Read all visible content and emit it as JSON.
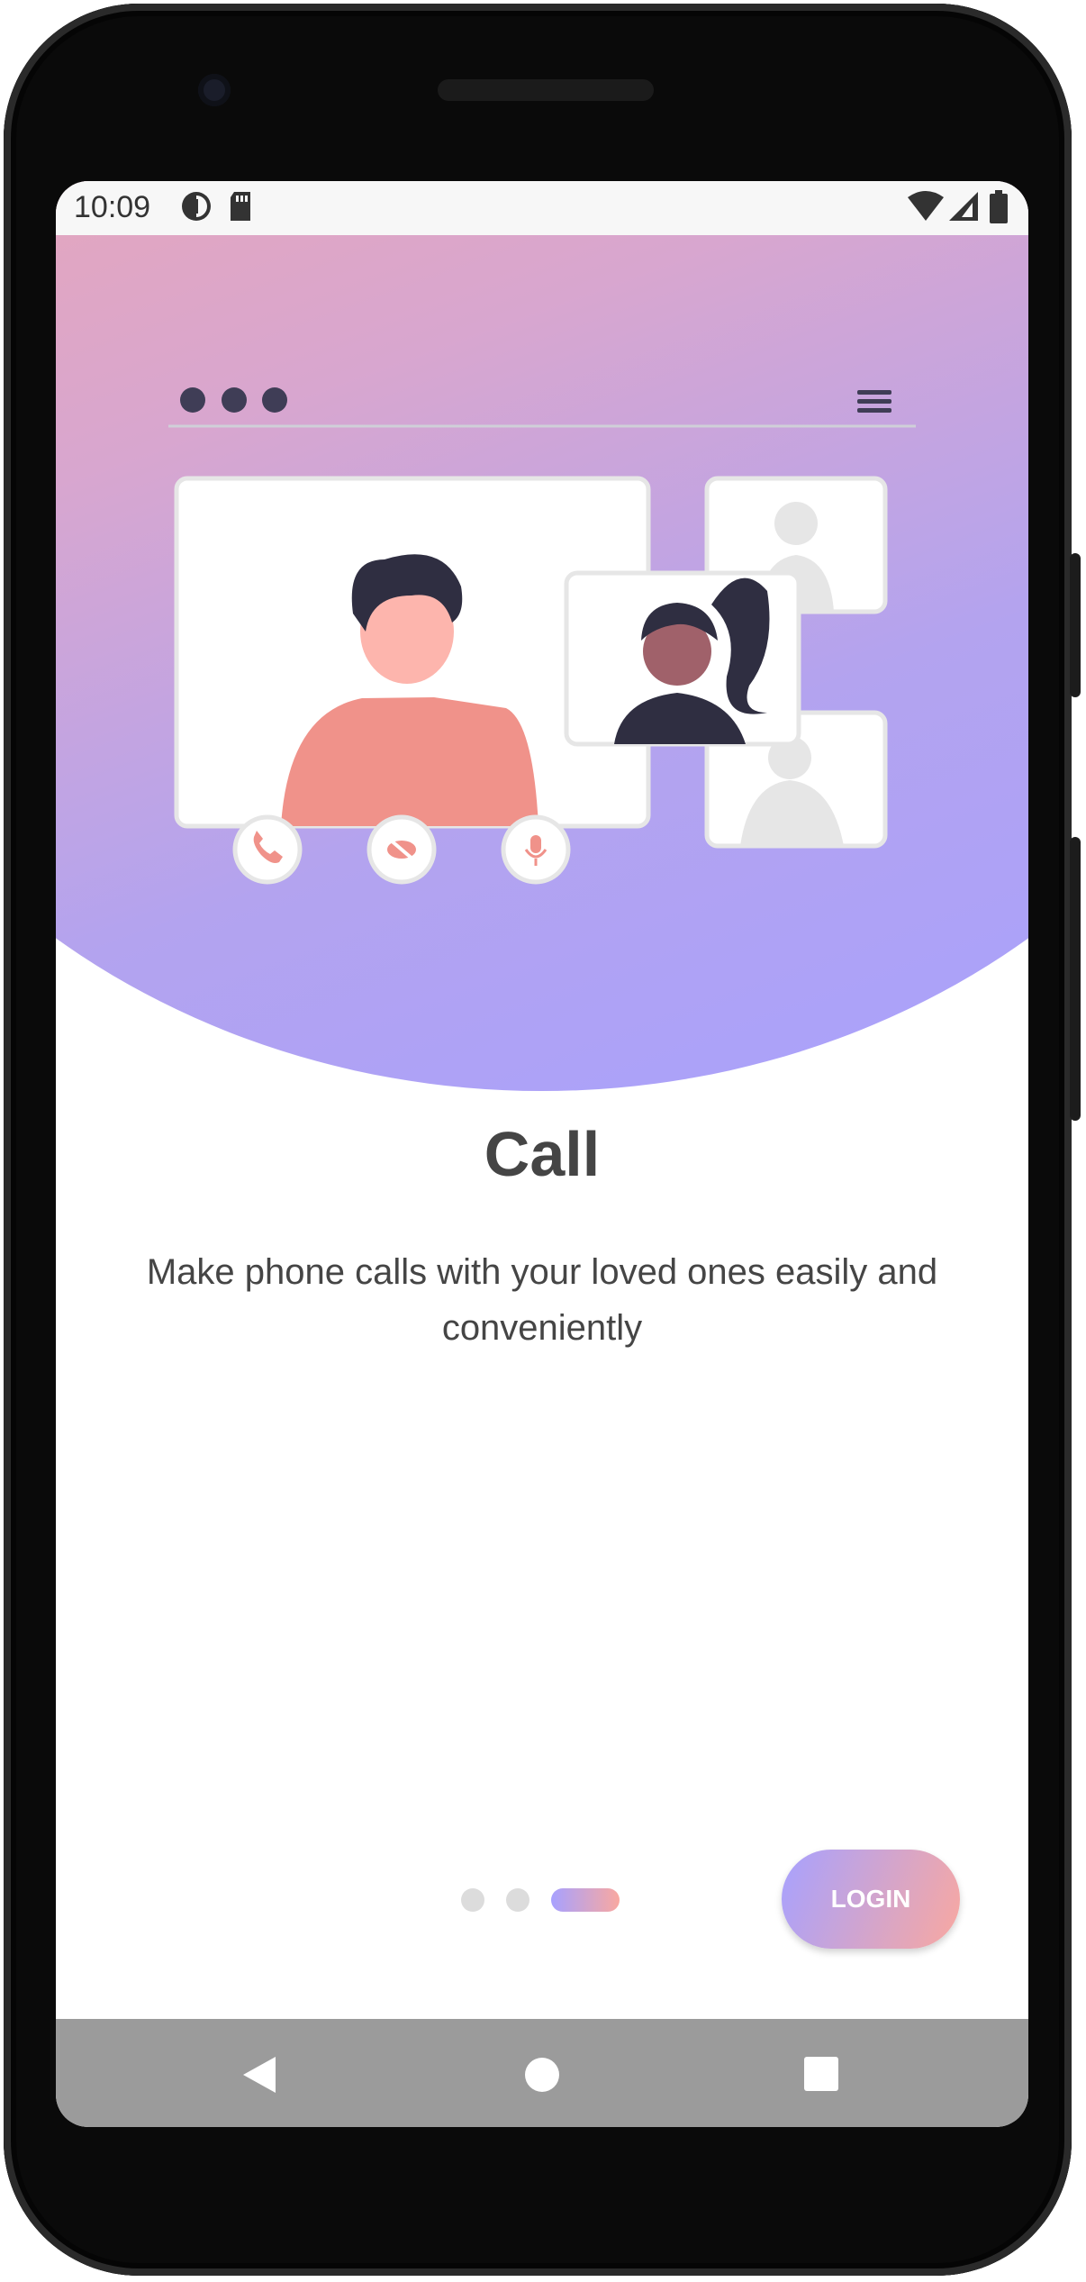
{
  "status_bar": {
    "time": "10:09",
    "left_icons": [
      "app-notification-icon",
      "sd-card-icon"
    ],
    "right_icons": [
      "wifi-icon",
      "cell-signal-icon",
      "battery-icon"
    ]
  },
  "illustration": {
    "description_icons": [
      "window-dots-icon",
      "menu-icon",
      "call-icon",
      "video-off-icon",
      "mic-icon"
    ]
  },
  "onboarding": {
    "title": "Call",
    "description": "Make phone calls with your loved ones easily and conveniently",
    "page_count": 3,
    "active_page": 3
  },
  "actions": {
    "login_label": "LOGIN"
  },
  "nav_bar": {
    "icons": [
      "back-icon",
      "home-icon",
      "recents-icon"
    ]
  },
  "colors": {
    "gradient_start": "#f9a8a0",
    "gradient_end": "#a7a1ff",
    "text": "#454545",
    "dark_figure": "#2f2e41",
    "pink_figure": "#f0928a"
  }
}
